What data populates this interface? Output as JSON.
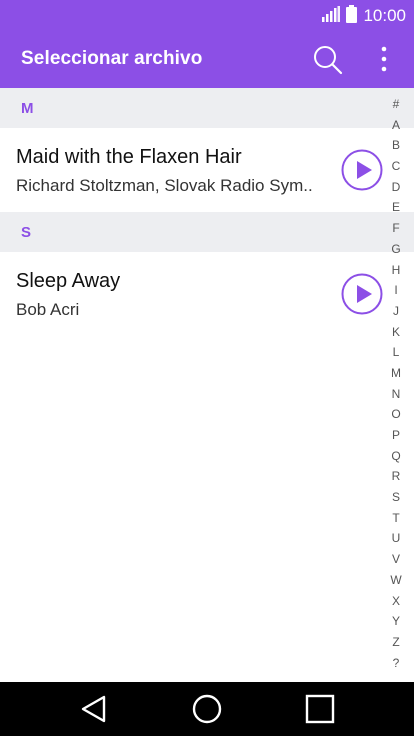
{
  "status": {
    "time": "10:00",
    "signal_icon": "signal-icon",
    "battery_icon": "battery-icon"
  },
  "appbar": {
    "title": "Seleccionar archivo",
    "search_icon": "search-icon",
    "menu_icon": "more-vert-icon"
  },
  "sections": [
    {
      "letter": "M",
      "items": [
        {
          "title": "Maid with the Flaxen Hair",
          "subtitle": "Richard Stoltzman, Slovak Radio Sym.."
        }
      ]
    },
    {
      "letter": "S",
      "items": [
        {
          "title": "Sleep Away",
          "subtitle": "Bob Acri"
        }
      ]
    }
  ],
  "index_letters": [
    "#",
    "A",
    "B",
    "C",
    "D",
    "E",
    "F",
    "G",
    "H",
    "I",
    "J",
    "K",
    "L",
    "M",
    "N",
    "O",
    "P",
    "Q",
    "R",
    "S",
    "T",
    "U",
    "V",
    "W",
    "X",
    "Y",
    "Z",
    "?"
  ],
  "navbar": {
    "back_icon": "back-icon",
    "home_icon": "home-icon",
    "recents_icon": "recents-icon"
  },
  "colors": {
    "accent": "#8c4fe6",
    "section_bg": "#edeef1",
    "navbar_bg": "#000000"
  }
}
